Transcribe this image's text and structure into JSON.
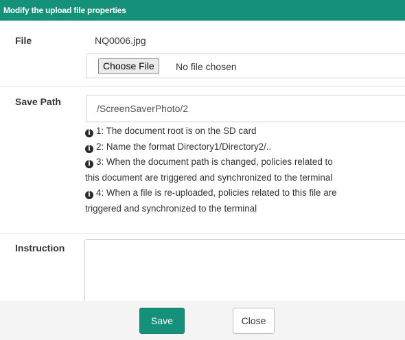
{
  "dialog": {
    "title": "Modify the upload file properties"
  },
  "file": {
    "label": "File",
    "current_name": "NQ0006.jpg",
    "choose_button": "Choose File",
    "no_file_text": "No file chosen"
  },
  "save_path": {
    "label": "Save Path",
    "value": "/ScreenSaverPhoto/2",
    "notes": [
      "1: The document root is on the SD card",
      "2: Name the format Directory1/Directory2/..",
      "3: When the document path is changed, policies related to",
      "this document are triggered and synchronized to the terminal",
      "4: When a file is re-uploaded, policies related to this file are",
      "triggered and synchronized to the terminal"
    ]
  },
  "instruction": {
    "label": "Instruction",
    "value": ""
  },
  "footer": {
    "save_label": "Save",
    "close_label": "Close"
  },
  "colors": {
    "accent": "#159079",
    "footer_bg": "#f4f4f4"
  }
}
